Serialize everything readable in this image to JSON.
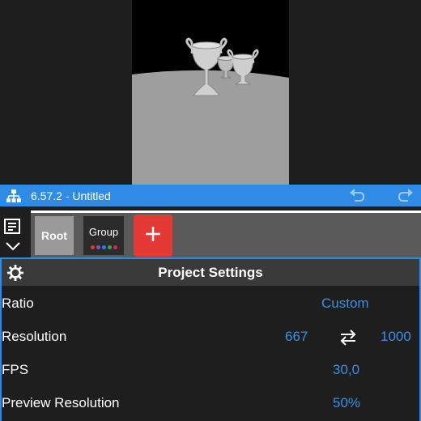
{
  "titlebar": {
    "title": "6.57.2 - Untitled"
  },
  "scenes": {
    "root_label": "Root",
    "group_label": "Group",
    "group_dot_colors": [
      "#e53935",
      "#7e57c2",
      "#2979ff",
      "#43a047",
      "#e91e63"
    ]
  },
  "panel": {
    "title": "Project Settings",
    "ratio_label": "Ratio",
    "ratio_value": "Custom",
    "resolution_label": "Resolution",
    "resolution_width": "667",
    "resolution_height": "1000",
    "fps_label": "FPS",
    "fps_value": "30,0",
    "preview_label": "Preview Resolution",
    "preview_value": "50%"
  },
  "colors": {
    "accent": "#2f8ce6",
    "value_text": "#3d8fe6",
    "add_button": "#e53935"
  }
}
